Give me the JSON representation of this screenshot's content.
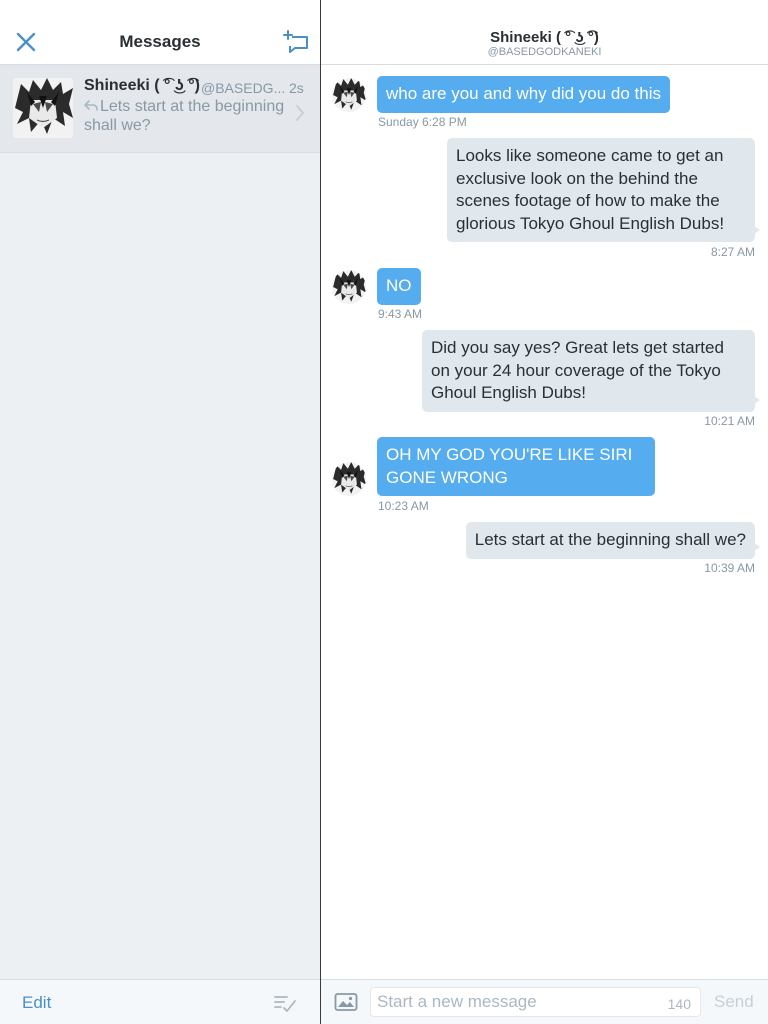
{
  "sidebar": {
    "title": "Messages",
    "footer": {
      "edit_label": "Edit"
    },
    "conversation": {
      "name": "Shineeki ( ͡° ͜ʖ ͡°)",
      "handle": "@BASEDG...",
      "time": "2s",
      "preview": "Lets start at the beginning shall we?"
    }
  },
  "chat": {
    "header": {
      "name": "Shineeki ( ͡° ͜ʖ ͡°)",
      "handle": "@BASEDGODKANEKI"
    },
    "messages": [
      {
        "direction": "incoming",
        "text": "who are you and why did you do this",
        "time": "Sunday 6:28 PM"
      },
      {
        "direction": "outgoing",
        "text": "Looks like someone came to get an exclusive look on the behind the scenes footage of how to make the glorious Tokyo Ghoul English Dubs!",
        "time": "8:27 AM"
      },
      {
        "direction": "incoming",
        "text": "NO",
        "time": "9:43 AM"
      },
      {
        "direction": "outgoing",
        "text": "Did you say yes? Great lets get started on your 24 hour coverage of the Tokyo Ghoul English Dubs!",
        "time": "10:21 AM"
      },
      {
        "direction": "incoming",
        "text": "OH MY GOD YOU'RE LIKE SIRI GONE WRONG",
        "time": "10:23 AM"
      },
      {
        "direction": "outgoing",
        "text": "Lets start at the beginning shall we?",
        "time": "10:39 AM"
      }
    ],
    "composer": {
      "placeholder": "Start a new message",
      "char_count": "140",
      "send_label": "Send"
    }
  },
  "icons": {
    "close": "close-icon",
    "compose": "compose-message-icon",
    "reply": "reply-arrow-icon",
    "chevron": "chevron-right-icon",
    "mark_read": "mark-all-read-icon",
    "photo": "photo-icon",
    "avatar": "manga-avatar"
  },
  "colors": {
    "accent": "#4a90c7",
    "incoming_bubble": "#55acee",
    "outgoing_bubble": "#e1e8ed",
    "sidebar_bg": "#edf0f3",
    "selected_row": "#e4e8ec",
    "muted_text": "#8899a6"
  }
}
